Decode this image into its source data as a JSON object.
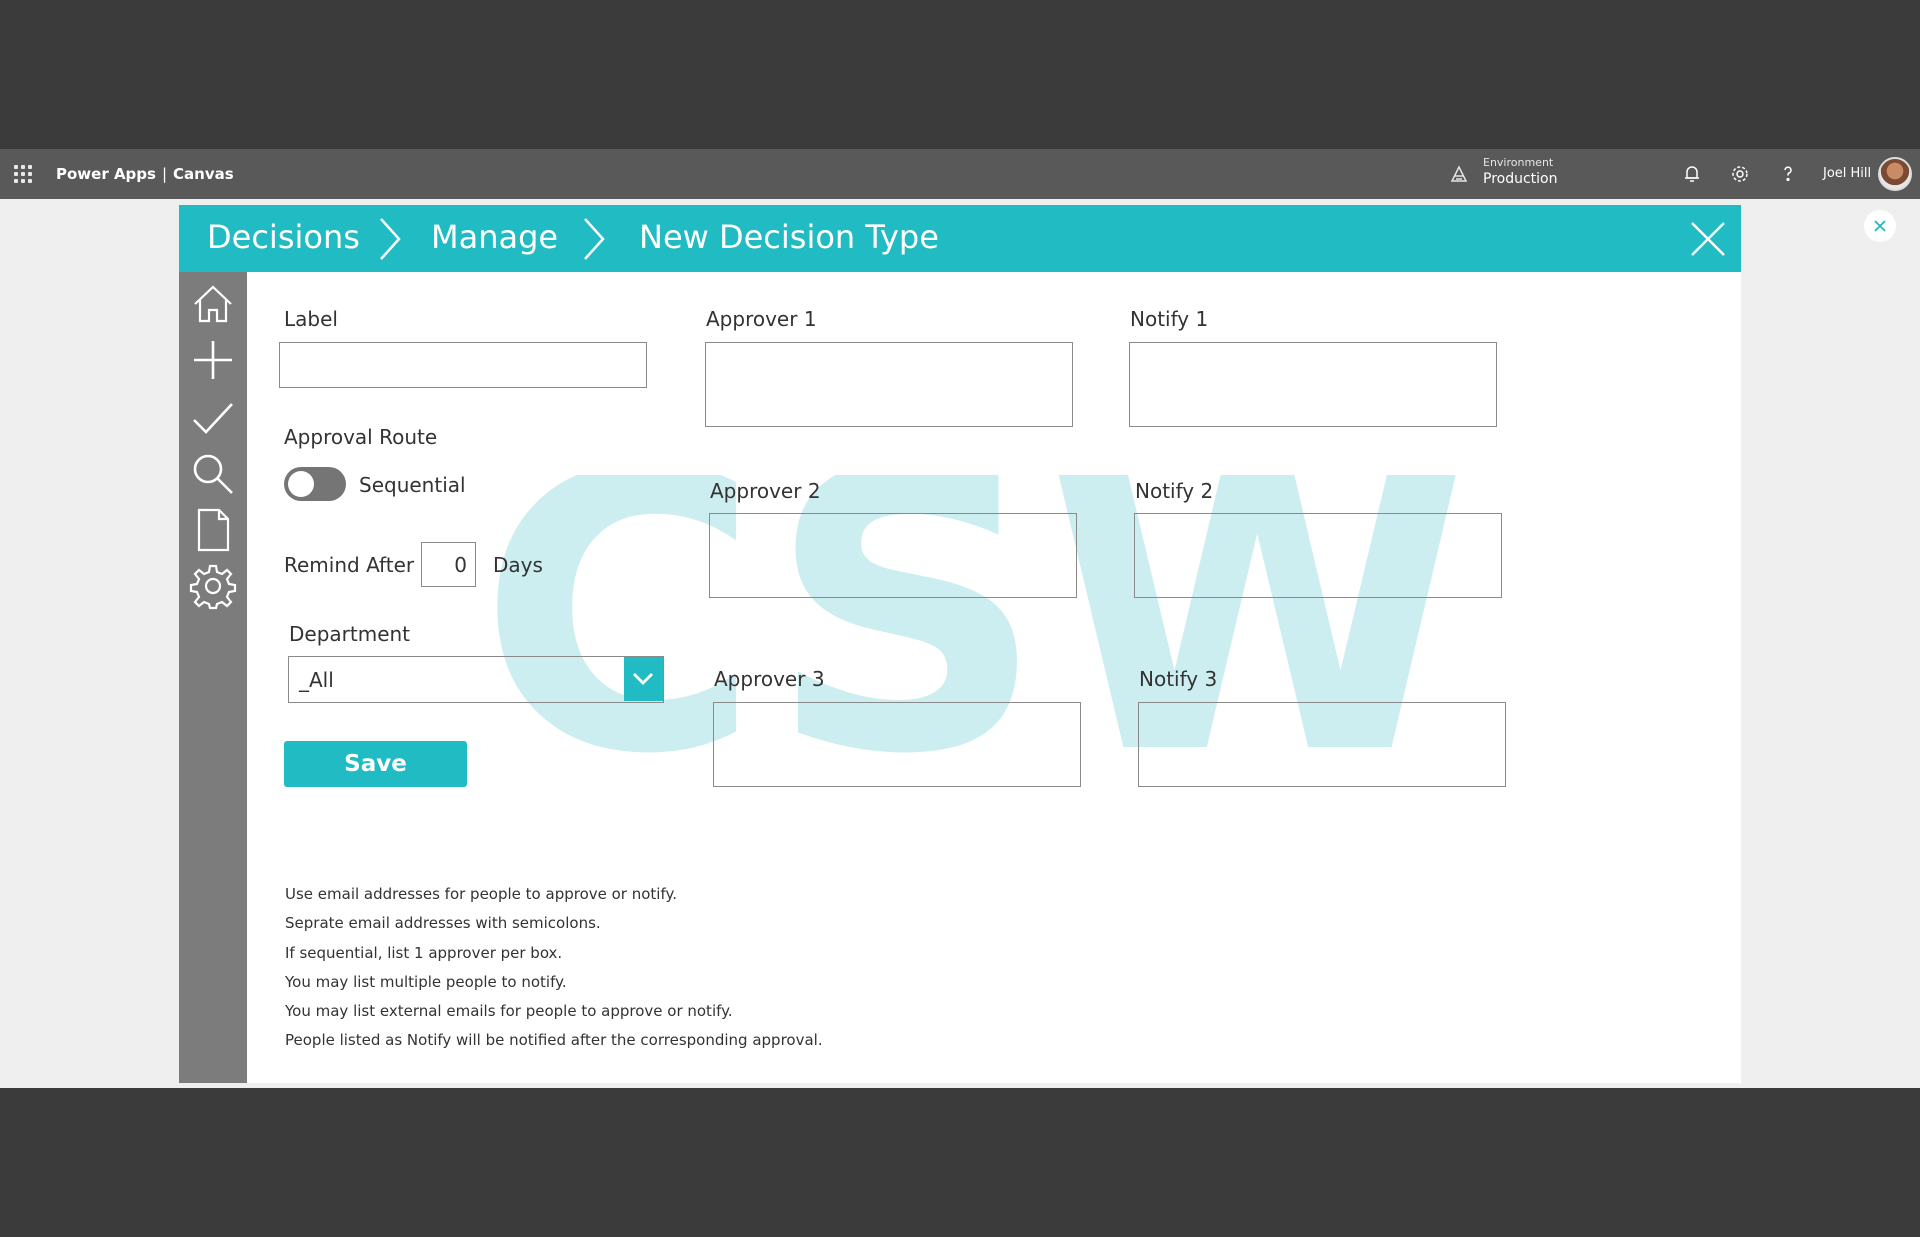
{
  "topbar": {
    "app_name": "Power Apps",
    "separator": "|",
    "app_type": "Canvas",
    "environment_label": "Environment",
    "environment_value": "Production",
    "user_name": "Joel Hill"
  },
  "header": {
    "crumbs": [
      "Decisions",
      "Manage",
      "New Decision Type"
    ]
  },
  "sidebar": {
    "items": [
      "home-icon",
      "add-icon",
      "approve-icon",
      "search-icon",
      "document-icon",
      "settings-icon"
    ]
  },
  "watermark": {
    "text": "CSW",
    "color": "#cdeef0"
  },
  "form": {
    "label_title": "Label",
    "label_value": "",
    "approval_route_title": "Approval Route",
    "toggle_label": "Sequential",
    "toggle_on": false,
    "remind_after": "Remind After",
    "remind_value": "0",
    "remind_unit": "Days",
    "department_title": "Department",
    "department_value": "_All",
    "save_label": "Save",
    "approvers": [
      {
        "title": "Approver 1",
        "value": ""
      },
      {
        "title": "Approver 2",
        "value": ""
      },
      {
        "title": "Approver 3",
        "value": ""
      }
    ],
    "notifies": [
      {
        "title": "Notify 1",
        "value": ""
      },
      {
        "title": "Notify 2",
        "value": ""
      },
      {
        "title": "Notify 3",
        "value": ""
      }
    ]
  },
  "notes": [
    "Use email addresses for people to approve or notify.",
    "Seprate email addresses with semicolons.",
    "If sequential, list 1 approver per box.",
    "You may list multiple people to notify.",
    "You may list external emails for people to approve or notify.",
    "People listed as Notify will be notified after the corresponding approval."
  ],
  "colors": {
    "accent": "#20bbc3",
    "sidebar": "#7c7c7c",
    "topbar": "#595959",
    "background": "#3b3b3b"
  }
}
